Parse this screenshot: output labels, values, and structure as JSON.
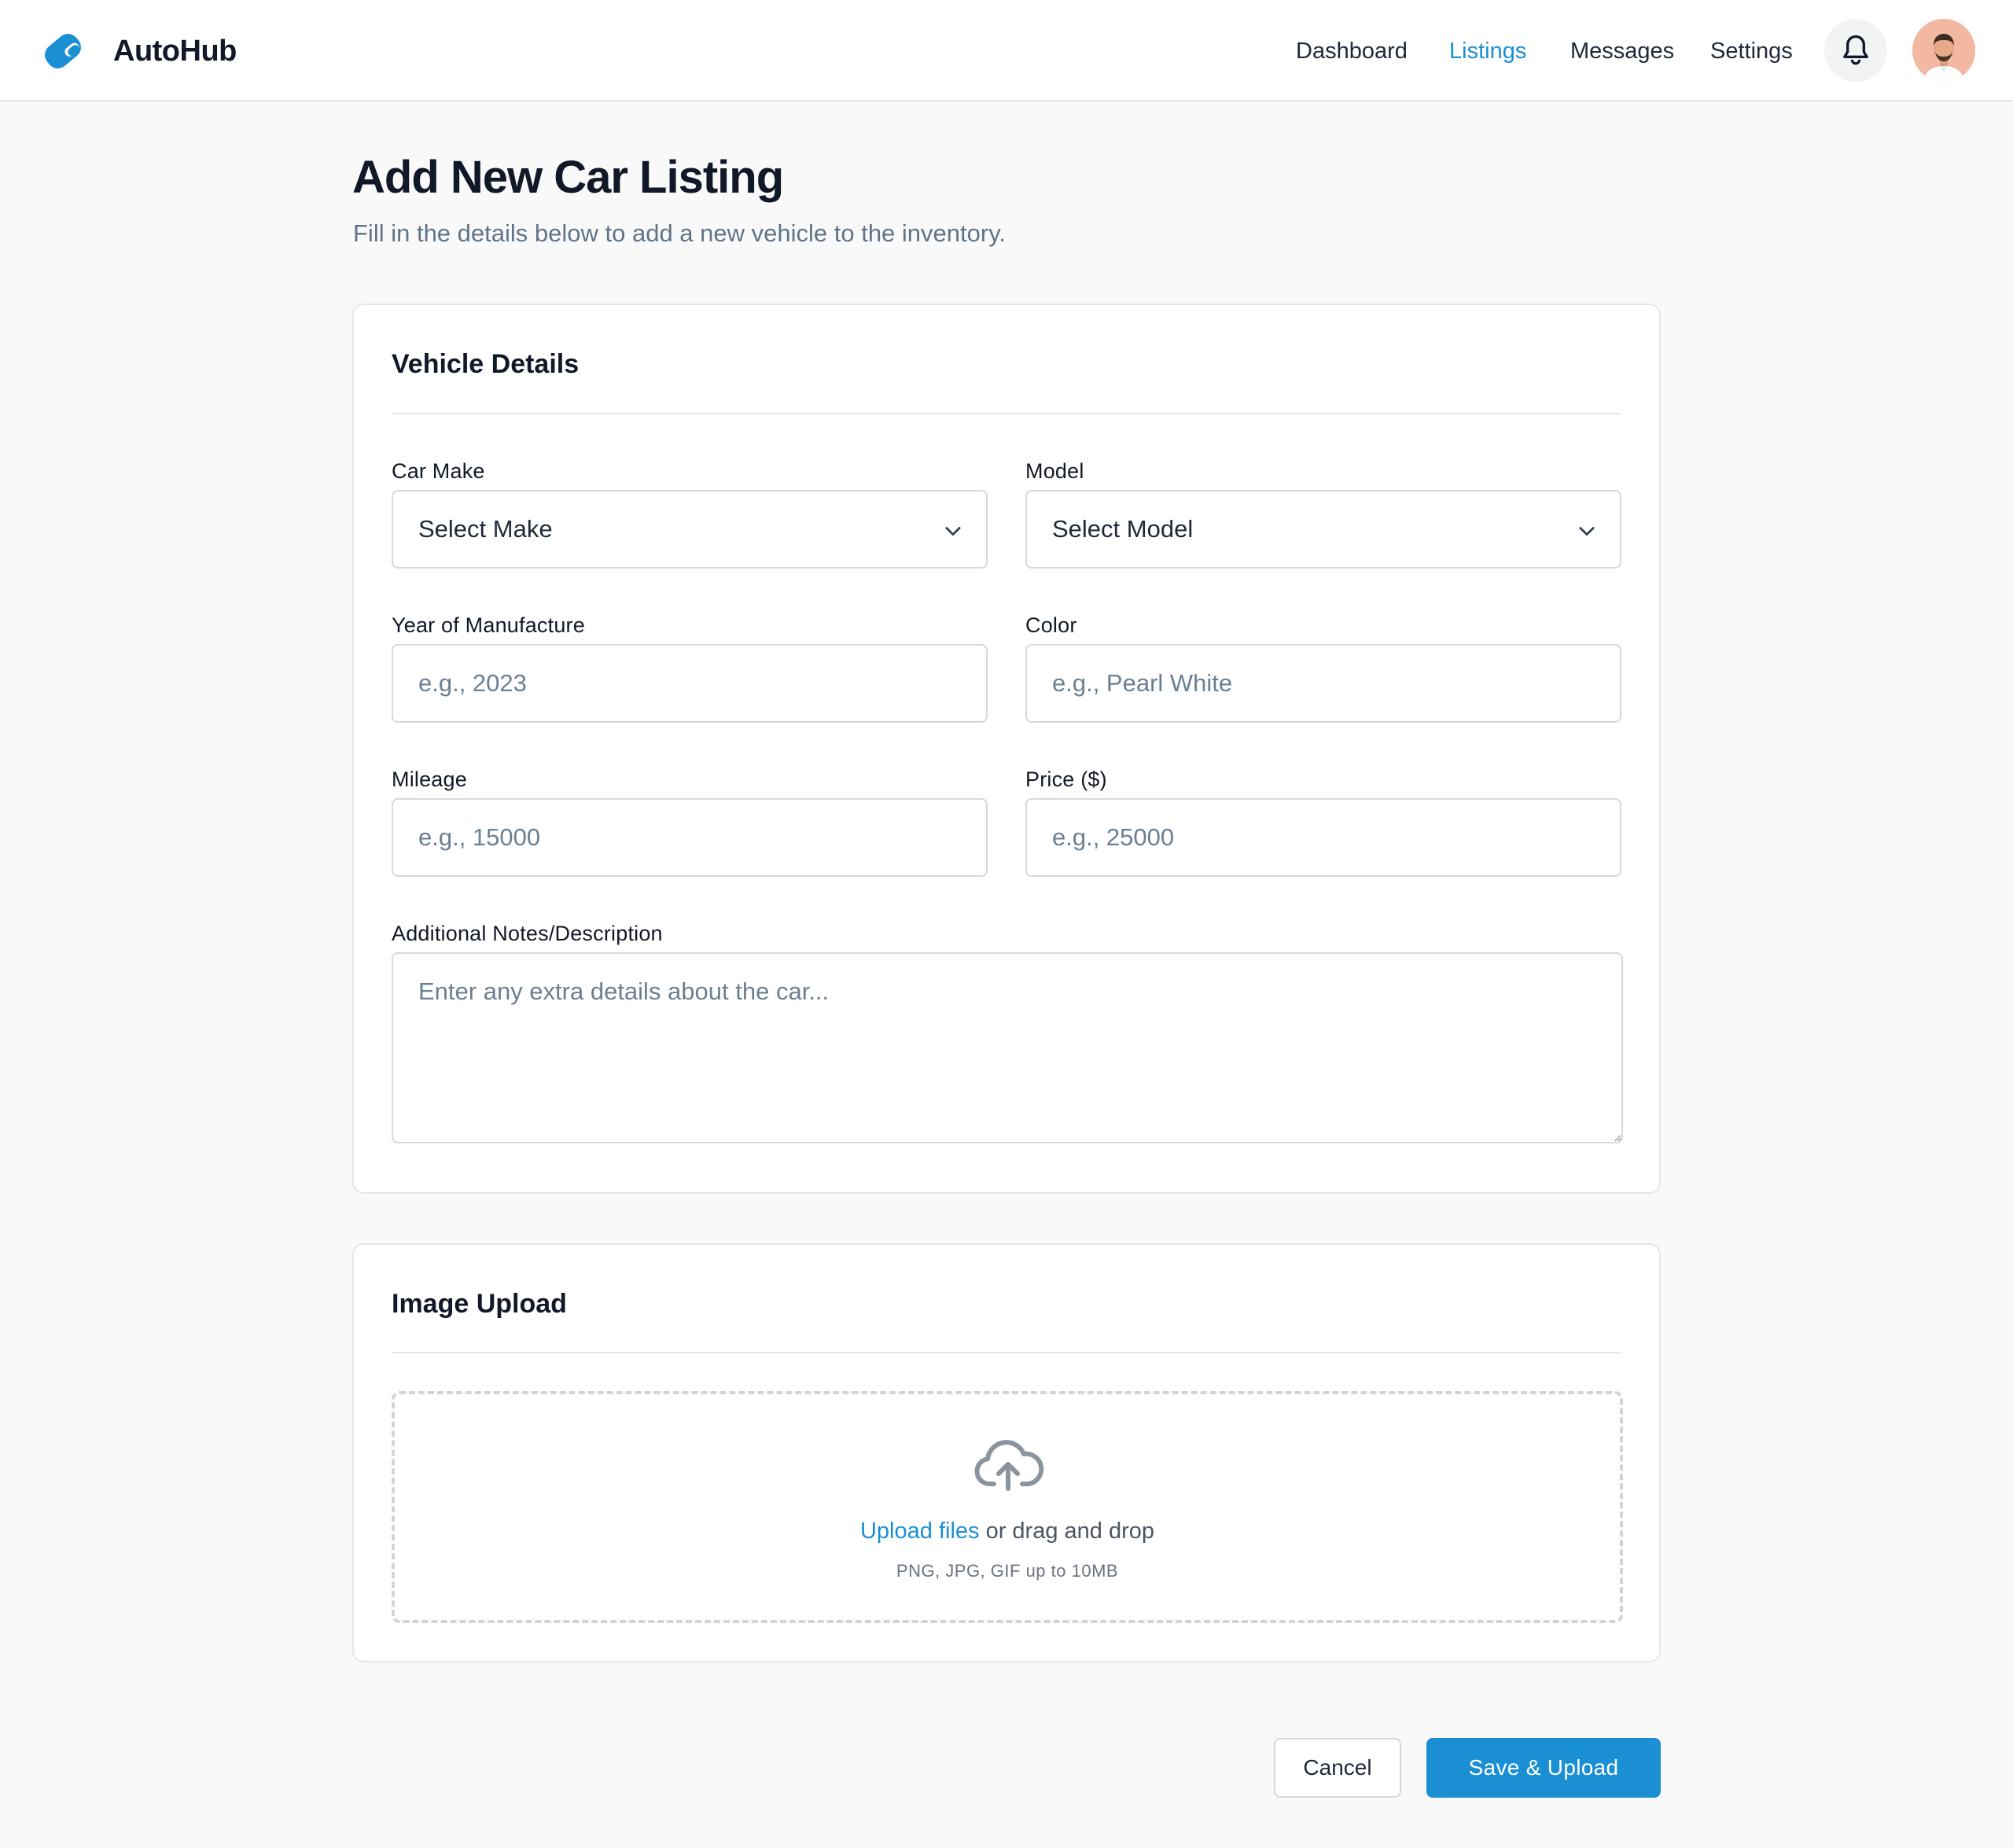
{
  "app": {
    "name": "AutoHub",
    "accent_color": "#1b8fd4"
  },
  "nav": {
    "items": [
      {
        "label": "Dashboard",
        "active": false
      },
      {
        "label": "Listings",
        "active": true
      },
      {
        "label": "Messages",
        "active": false
      },
      {
        "label": "Settings",
        "active": false
      }
    ],
    "notification_icon": "bell-icon",
    "avatar_icon": "user-avatar"
  },
  "page": {
    "title": "Add New Car Listing",
    "subtitle": "Fill in the details below to add a new vehicle to the inventory."
  },
  "vehicle_details": {
    "title": "Vehicle Details",
    "make": {
      "label": "Car Make",
      "value": "Select Make"
    },
    "model": {
      "label": "Model",
      "value": "Select Model"
    },
    "year": {
      "label": "Year of Manufacture",
      "placeholder": "e.g., 2023"
    },
    "color": {
      "label": "Color",
      "placeholder": "e.g., Pearl White"
    },
    "mileage": {
      "label": "Mileage",
      "placeholder": "e.g., 15000"
    },
    "price": {
      "label": "Price ($)",
      "placeholder": "e.g., 25000"
    },
    "notes": {
      "label": "Additional Notes/Description",
      "placeholder": "Enter any extra details about the car..."
    }
  },
  "image_upload": {
    "title": "Image Upload",
    "upload_link": "Upload files",
    "drag_text": " or drag and drop",
    "hint": "PNG, JPG, GIF up to 10MB",
    "icon": "cloud-upload-icon"
  },
  "actions": {
    "cancel_label": "Cancel",
    "save_label": "Save & Upload"
  }
}
